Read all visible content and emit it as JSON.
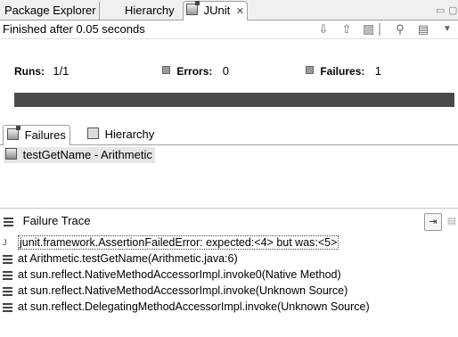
{
  "tabs": [
    {
      "label": "Package Explorer",
      "active": false
    },
    {
      "label": "Hierarchy",
      "active": false
    },
    {
      "label": "JUnit",
      "active": true,
      "close": "✕"
    }
  ],
  "status": "Finished after 0.05 seconds",
  "counters": {
    "runs_label": "Runs:",
    "runs_value": "1/1",
    "errors_label": "Errors:",
    "errors_value": "0",
    "failures_label": "Failures:",
    "failures_value": "1"
  },
  "progress": {
    "fraction": 1.0,
    "color": "#4a4a4a"
  },
  "subtabs": [
    {
      "label": "Failures",
      "active": true
    },
    {
      "label": "Hierarchy",
      "active": false
    }
  ],
  "failures": [
    {
      "label": "testGetName - Arithmetic"
    }
  ],
  "trace_title": "Failure Trace",
  "trace": [
    "junit.framework.AssertionFailedError: expected:<4> but was:<5>",
    "at Arithmetic.testGetName(Arithmetic.java:6)",
    "at sun.reflect.NativeMethodAccessorImpl.invoke0(Native Method)",
    "at sun.reflect.NativeMethodAccessorImpl.invoke(Unknown Source)",
    "at sun.reflect.DelegatingMethodAccessorImpl.invoke(Unknown Source)"
  ],
  "icons": {
    "next_failure": "next-failure-icon",
    "previous_failure": "previous-failure-icon",
    "show_failures_only": "failures-only-icon",
    "rerun": "rerun-icon",
    "history": "history-icon",
    "view_menu": "view-menu-icon"
  }
}
